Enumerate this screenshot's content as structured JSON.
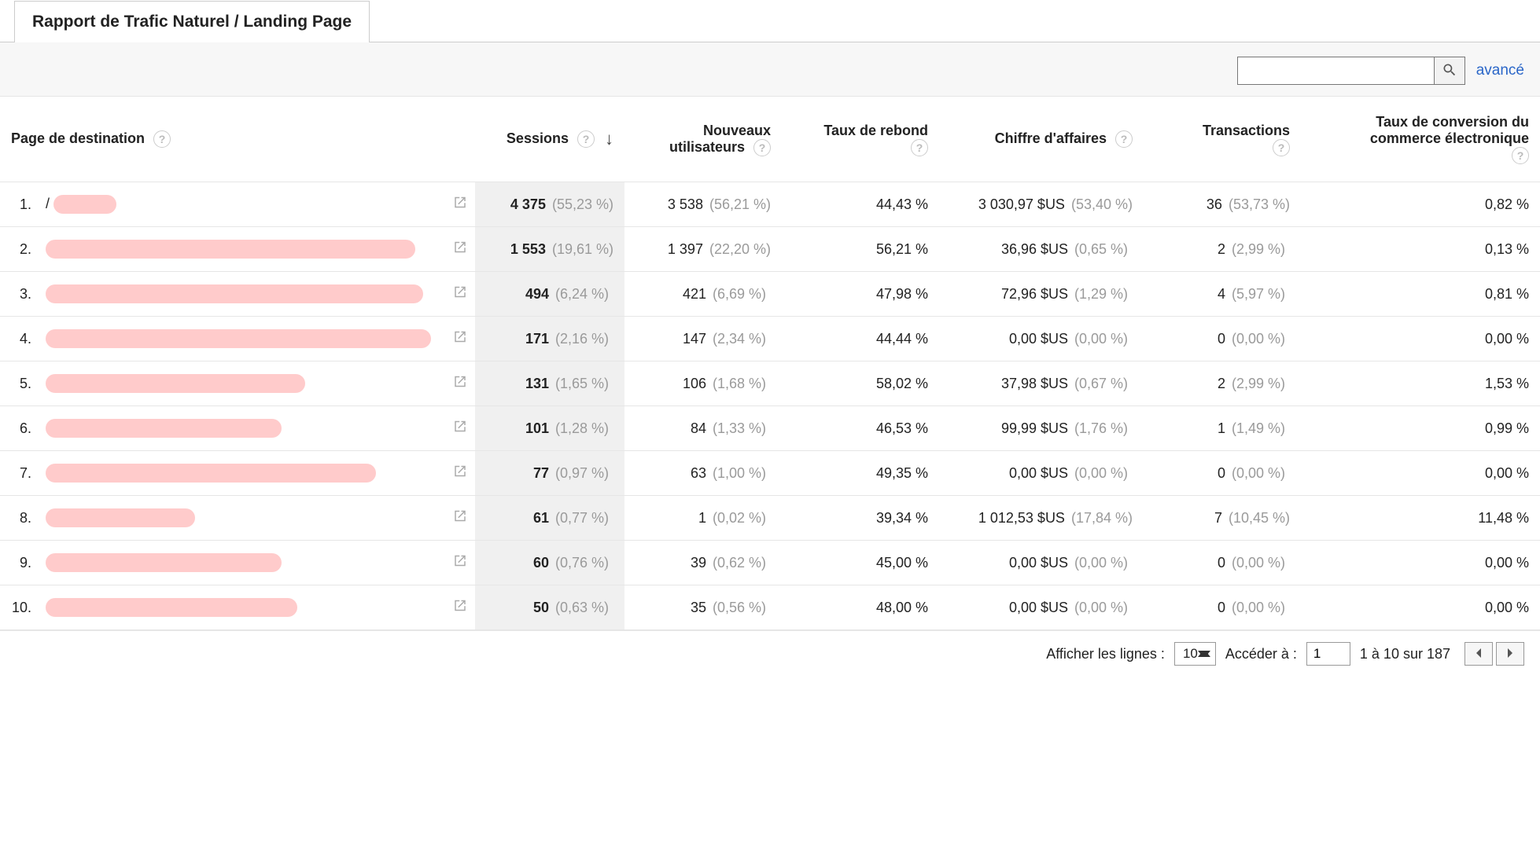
{
  "tab_title": "Rapport de Trafic Naturel / Landing Page",
  "toolbar": {
    "advanced_label": "avancé",
    "search_placeholder": ""
  },
  "columns": {
    "landing_page": "Page de destination",
    "sessions": "Sessions",
    "new_users": "Nouveaux utilisateurs",
    "bounce_rate": "Taux de rebond",
    "revenue": "Chiffre d'affaires",
    "transactions": "Transactions",
    "ecom_cr": "Taux de conversion du commerce électronique"
  },
  "rows": [
    {
      "idx": "1.",
      "path_prefix": "/",
      "redact_w": 80,
      "sessions": "4 375",
      "sessions_pct": "(55,23 %)",
      "new_users": "3 538",
      "new_users_pct": "(56,21 %)",
      "bounce": "44,43 %",
      "revenue": "3 030,97 $US",
      "revenue_pct": "(53,40 %)",
      "trans": "36",
      "trans_pct": "(53,73 %)",
      "cr": "0,82 %"
    },
    {
      "idx": "2.",
      "path_prefix": "",
      "redact_w": 470,
      "sessions": "1 553",
      "sessions_pct": "(19,61 %)",
      "new_users": "1 397",
      "new_users_pct": "(22,20 %)",
      "bounce": "56,21 %",
      "revenue": "36,96 $US",
      "revenue_pct": "(0,65 %)",
      "trans": "2",
      "trans_pct": "(2,99 %)",
      "cr": "0,13 %"
    },
    {
      "idx": "3.",
      "path_prefix": "",
      "redact_w": 480,
      "sessions": "494",
      "sessions_pct": "(6,24 %)",
      "new_users": "421",
      "new_users_pct": "(6,69 %)",
      "bounce": "47,98 %",
      "revenue": "72,96 $US",
      "revenue_pct": "(1,29 %)",
      "trans": "4",
      "trans_pct": "(5,97 %)",
      "cr": "0,81 %"
    },
    {
      "idx": "4.",
      "path_prefix": "",
      "redact_w": 490,
      "sessions": "171",
      "sessions_pct": "(2,16 %)",
      "new_users": "147",
      "new_users_pct": "(2,34 %)",
      "bounce": "44,44 %",
      "revenue": "0,00 $US",
      "revenue_pct": "(0,00 %)",
      "trans": "0",
      "trans_pct": "(0,00 %)",
      "cr": "0,00 %"
    },
    {
      "idx": "5.",
      "path_prefix": "",
      "redact_w": 330,
      "sessions": "131",
      "sessions_pct": "(1,65 %)",
      "new_users": "106",
      "new_users_pct": "(1,68 %)",
      "bounce": "58,02 %",
      "revenue": "37,98 $US",
      "revenue_pct": "(0,67 %)",
      "trans": "2",
      "trans_pct": "(2,99 %)",
      "cr": "1,53 %"
    },
    {
      "idx": "6.",
      "path_prefix": "",
      "redact_w": 300,
      "sessions": "101",
      "sessions_pct": "(1,28 %)",
      "new_users": "84",
      "new_users_pct": "(1,33 %)",
      "bounce": "46,53 %",
      "revenue": "99,99 $US",
      "revenue_pct": "(1,76 %)",
      "trans": "1",
      "trans_pct": "(1,49 %)",
      "cr": "0,99 %"
    },
    {
      "idx": "7.",
      "path_prefix": "",
      "redact_w": 420,
      "sessions": "77",
      "sessions_pct": "(0,97 %)",
      "new_users": "63",
      "new_users_pct": "(1,00 %)",
      "bounce": "49,35 %",
      "revenue": "0,00 $US",
      "revenue_pct": "(0,00 %)",
      "trans": "0",
      "trans_pct": "(0,00 %)",
      "cr": "0,00 %"
    },
    {
      "idx": "8.",
      "path_prefix": "",
      "redact_w": 190,
      "sessions": "61",
      "sessions_pct": "(0,77 %)",
      "new_users": "1",
      "new_users_pct": "(0,02 %)",
      "bounce": "39,34 %",
      "revenue": "1 012,53 $US",
      "revenue_pct": "(17,84 %)",
      "trans": "7",
      "trans_pct": "(10,45 %)",
      "cr": "11,48 %"
    },
    {
      "idx": "9.",
      "path_prefix": "",
      "redact_w": 300,
      "sessions": "60",
      "sessions_pct": "(0,76 %)",
      "new_users": "39",
      "new_users_pct": "(0,62 %)",
      "bounce": "45,00 %",
      "revenue": "0,00 $US",
      "revenue_pct": "(0,00 %)",
      "trans": "0",
      "trans_pct": "(0,00 %)",
      "cr": "0,00 %"
    },
    {
      "idx": "10.",
      "path_prefix": "",
      "redact_w": 320,
      "sessions": "50",
      "sessions_pct": "(0,63 %)",
      "new_users": "35",
      "new_users_pct": "(0,56 %)",
      "bounce": "48,00 %",
      "revenue": "0,00 $US",
      "revenue_pct": "(0,00 %)",
      "trans": "0",
      "trans_pct": "(0,00 %)",
      "cr": "0,00 %"
    }
  ],
  "footer": {
    "show_rows_label": "Afficher les lignes :",
    "rows_per_page": "10",
    "goto_label": "Accéder à :",
    "goto_value": "1",
    "range_text": "1 à 10 sur 187"
  }
}
